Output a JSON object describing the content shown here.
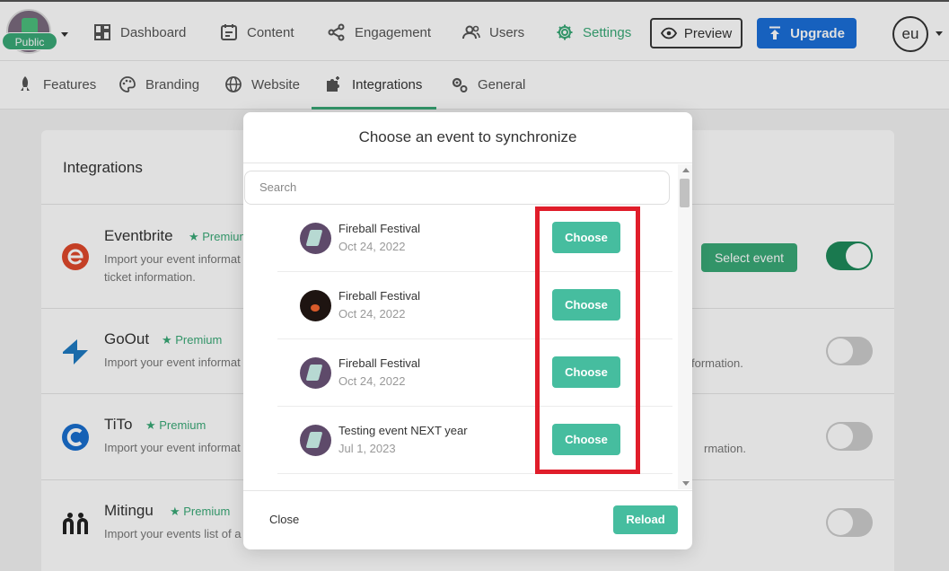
{
  "account": {
    "visibility_badge": "Public",
    "user_initials": "eu"
  },
  "nav": {
    "items": [
      {
        "label": "Dashboard"
      },
      {
        "label": "Content"
      },
      {
        "label": "Engagement"
      },
      {
        "label": "Users"
      },
      {
        "label": "Settings"
      }
    ],
    "preview_label": "Preview",
    "upgrade_label": "Upgrade",
    "active": "Settings"
  },
  "subnav": {
    "items": [
      {
        "label": "Features"
      },
      {
        "label": "Branding"
      },
      {
        "label": "Website"
      },
      {
        "label": "Integrations"
      },
      {
        "label": "General"
      }
    ],
    "active": "Integrations"
  },
  "integrations": {
    "title": "Integrations",
    "items": [
      {
        "name": "Eventbrite",
        "premium": "★ Premium",
        "desc_line1": "Import your event informat",
        "desc_line2": "ticket information.",
        "desc_right": "",
        "enabled": true,
        "select_event_label": "Select event"
      },
      {
        "name": "GoOut",
        "premium": "★ Premium",
        "desc_line1": "Import your event informat",
        "desc_right": "formation.",
        "enabled": false
      },
      {
        "name": "TiTo",
        "premium": "★ Premium",
        "desc_line1": "Import your event informat",
        "desc_right": "rmation.",
        "enabled": false
      },
      {
        "name": "Mitingu",
        "premium": "★ Premium",
        "desc_line1": "Import your events list of a",
        "desc_right": "",
        "enabled": false
      }
    ]
  },
  "modal": {
    "title": "Choose an event to synchronize",
    "search_placeholder": "Search",
    "events": [
      {
        "name": "Fireball Festival",
        "date": "Oct 24, 2022",
        "button": "Choose"
      },
      {
        "name": "Fireball Festival",
        "date": "Oct 24, 2022",
        "button": "Choose"
      },
      {
        "name": "Fireball Festival",
        "date": "Oct 24, 2022",
        "button": "Choose"
      },
      {
        "name": "Testing event NEXT year",
        "date": "Jul 1, 2023",
        "button": "Choose"
      }
    ],
    "close_label": "Close",
    "reload_label": "Reload"
  },
  "colors": {
    "accent": "#3aa977",
    "choose_button": "#46bd9f",
    "upgrade": "#1b6fd9",
    "highlight_box": "#e01d2a"
  }
}
